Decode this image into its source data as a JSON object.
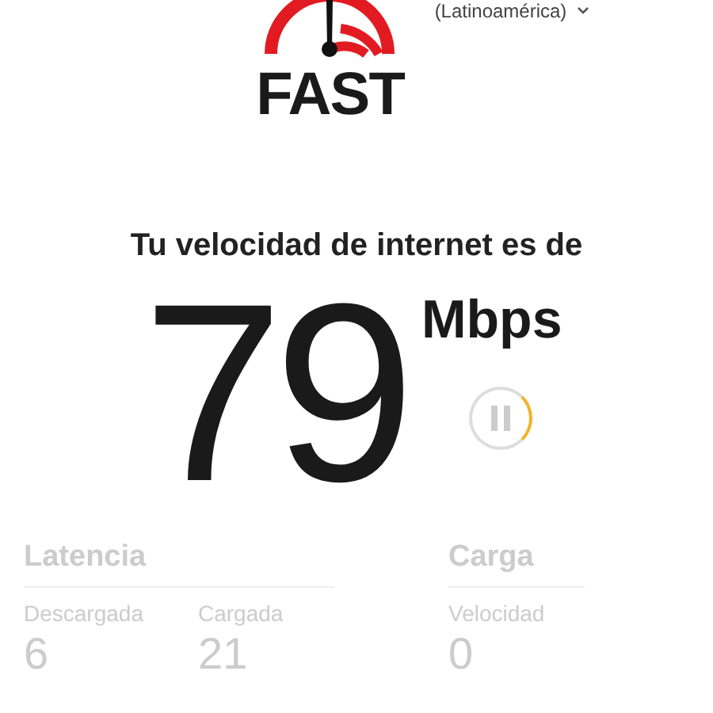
{
  "logo": {
    "text": "FAST"
  },
  "region": {
    "label": "(Latinoamérica)"
  },
  "headline": "Tu velocidad de internet es de",
  "speed": {
    "value": "79",
    "unit": "Mbps"
  },
  "details": [
    {
      "title": "Latencia",
      "metrics": [
        {
          "label": "Descargada",
          "value": "6"
        },
        {
          "label": "Cargada",
          "value": "21"
        }
      ]
    },
    {
      "title": "Carga",
      "metrics": [
        {
          "label": "Velocidad",
          "value": "0"
        }
      ]
    }
  ]
}
